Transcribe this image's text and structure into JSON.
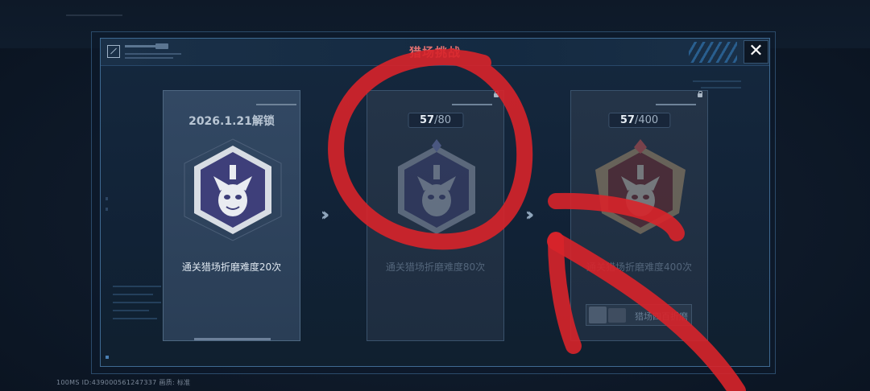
{
  "dialog": {
    "title": "猎场挑战",
    "close_label": "✕"
  },
  "cards": [
    {
      "unlock_text": "2026.1.21解锁",
      "description": "通关猎场折磨难度20次",
      "state": "active"
    },
    {
      "progress_current": "57",
      "progress_total": "/80",
      "description": "通关猎场折磨难度80次",
      "state": "locked"
    },
    {
      "progress_current": "57",
      "progress_total": "/400",
      "description": "通关猎场折磨难度400次",
      "state": "locked"
    }
  ],
  "reward": {
    "label": "猎场四百折磨"
  },
  "status_bar": {
    "text": "100MS  ID:439000561247337   画质: 标准"
  },
  "icons": {
    "close": "close-icon",
    "lock": "lock-icon",
    "arrow": "double-chevron-right-icon",
    "badge": "monkey-helmet-emblem-icon"
  },
  "colors": {
    "title": "#e07070",
    "annotation": "#d8242a",
    "accent_border": "#3f6a92"
  }
}
